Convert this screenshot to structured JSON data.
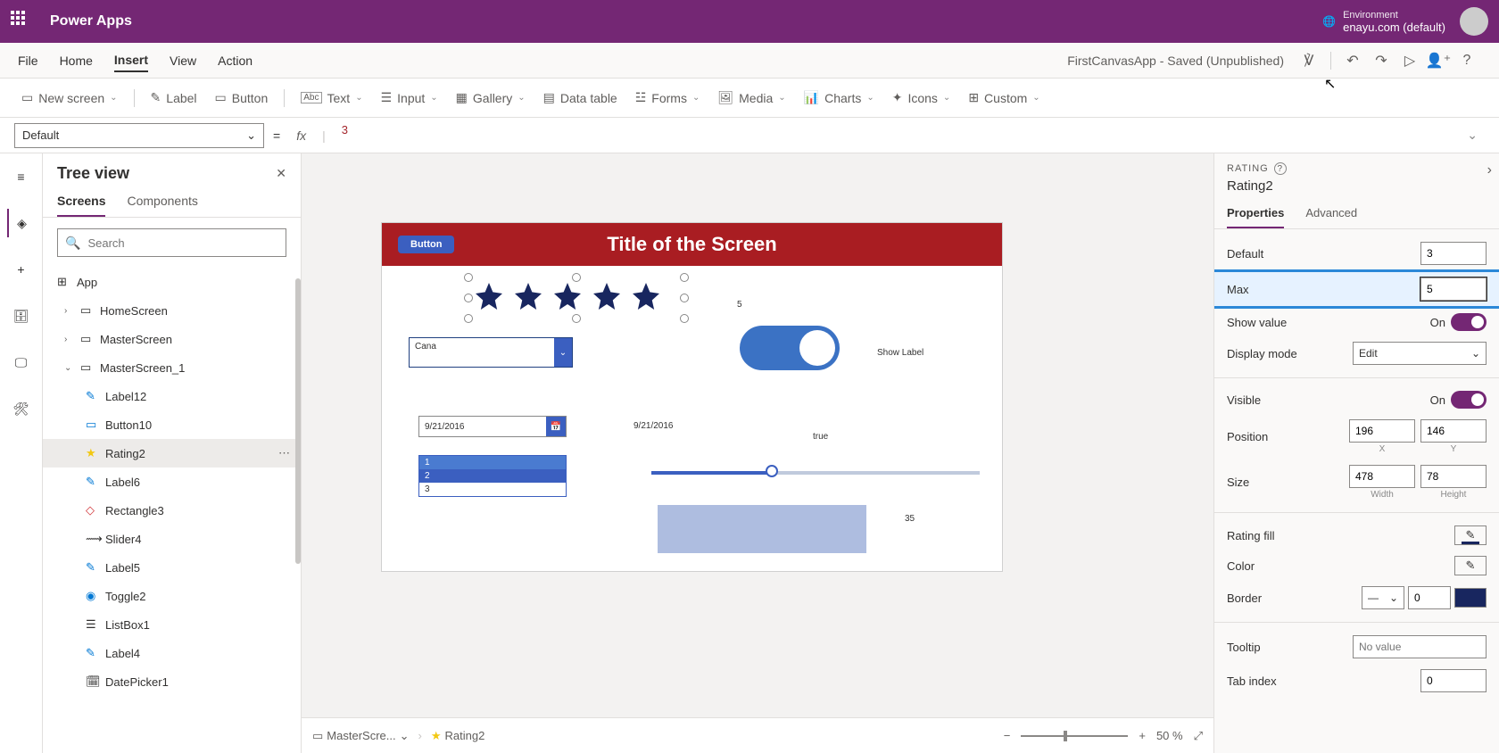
{
  "header": {
    "app_name": "Power Apps",
    "env_label": "Environment",
    "env_value": "enayu.com (default)"
  },
  "menu": {
    "items": [
      "File",
      "Home",
      "Insert",
      "View",
      "Action"
    ],
    "active": "Insert",
    "filename": "FirstCanvasApp - Saved (Unpublished)"
  },
  "ribbon": {
    "new_screen": "New screen",
    "label": "Label",
    "button": "Button",
    "text": "Text",
    "input": "Input",
    "gallery": "Gallery",
    "data_table": "Data table",
    "forms": "Forms",
    "media": "Media",
    "charts": "Charts",
    "icons": "Icons",
    "custom": "Custom"
  },
  "formula": {
    "property": "Default",
    "value": "3"
  },
  "tree": {
    "title": "Tree view",
    "tabs": {
      "screens": "Screens",
      "components": "Components"
    },
    "search_ph": "Search",
    "app": "App",
    "items": [
      {
        "name": "HomeScreen",
        "icon": "screen"
      },
      {
        "name": "MasterScreen",
        "icon": "screen"
      },
      {
        "name": "MasterScreen_1",
        "icon": "screen",
        "expanded": true,
        "children": [
          {
            "name": "Label12",
            "icon": "label"
          },
          {
            "name": "Button10",
            "icon": "button"
          },
          {
            "name": "Rating2",
            "icon": "rating",
            "selected": true
          },
          {
            "name": "Label6",
            "icon": "label"
          },
          {
            "name": "Rectangle3",
            "icon": "rect"
          },
          {
            "name": "Slider4",
            "icon": "slider"
          },
          {
            "name": "Label5",
            "icon": "label"
          },
          {
            "name": "Toggle2",
            "icon": "toggle"
          },
          {
            "name": "ListBox1",
            "icon": "listbox"
          },
          {
            "name": "Label4",
            "icon": "label"
          },
          {
            "name": "DatePicker1",
            "icon": "date"
          }
        ]
      }
    ]
  },
  "canvas": {
    "title": "Title of the Screen",
    "button_label": "Button",
    "rating_value": "5",
    "dropdown_value": "Cana",
    "toggle_label": "Show Label",
    "date_value": "9/21/2016",
    "date_label": "9/21/2016",
    "true_label": "true",
    "listbox": [
      "1",
      "2",
      "3"
    ],
    "slider_value": "35"
  },
  "breadcrumb": {
    "screen": "MasterScre...",
    "element": "Rating2"
  },
  "zoom": {
    "value": "50",
    "pct": "%"
  },
  "props": {
    "type": "RATING",
    "name": "Rating2",
    "tabs": {
      "properties": "Properties",
      "advanced": "Advanced"
    },
    "default_label": "Default",
    "default_val": "3",
    "max_label": "Max",
    "max_val": "5",
    "showvalue_label": "Show value",
    "on": "On",
    "displaymode_label": "Display mode",
    "displaymode_val": "Edit",
    "visible_label": "Visible",
    "position_label": "Position",
    "pos_x": "196",
    "pos_y": "146",
    "x_label": "X",
    "y_label": "Y",
    "size_label": "Size",
    "size_w": "478",
    "size_h": "78",
    "w_label": "Width",
    "h_label": "Height",
    "ratingfill_label": "Rating fill",
    "color_label": "Color",
    "border_label": "Border",
    "border_val": "0",
    "tooltip_label": "Tooltip",
    "tooltip_ph": "No value",
    "tabindex_label": "Tab index",
    "tabindex_val": "0"
  }
}
